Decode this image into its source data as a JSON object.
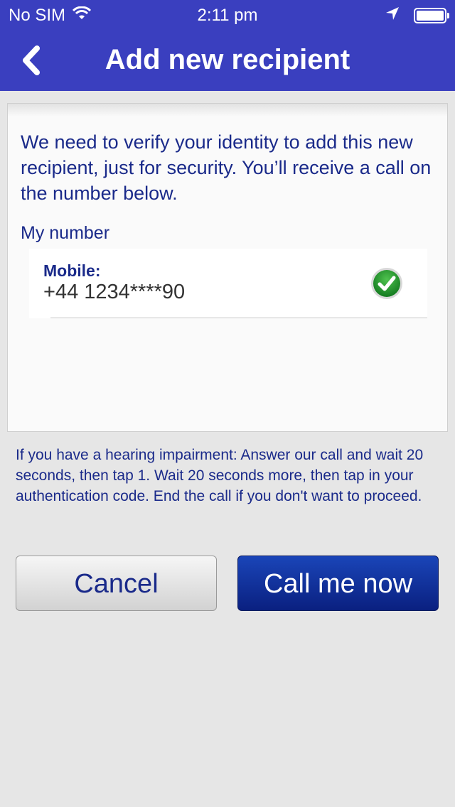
{
  "status_bar": {
    "carrier": "No SIM",
    "time": "2:11 pm"
  },
  "header": {
    "title": "Add new recipient",
    "back_icon": "chevron-left-icon"
  },
  "card": {
    "message": "We need to verify your identity to add this new recipient, just for security. You’ll receive a call on the number below.",
    "my_number_label": "My number",
    "number_type": "Mobile:",
    "number_value": "+44 1234****90",
    "selected_icon": "checkmark-icon"
  },
  "impairment_note": "If you have a hearing impairment: Answer our call and wait 20 seconds, then tap 1.  Wait 20 seconds more, then tap in your authentication code. End the call if you don't want to proceed.",
  "buttons": {
    "cancel": "Cancel",
    "call": "Call me now"
  },
  "colors": {
    "header": "#3a3fbf",
    "text": "#1a2a8a",
    "primary_button": "#0a2080",
    "check": "#1a8a2a"
  }
}
